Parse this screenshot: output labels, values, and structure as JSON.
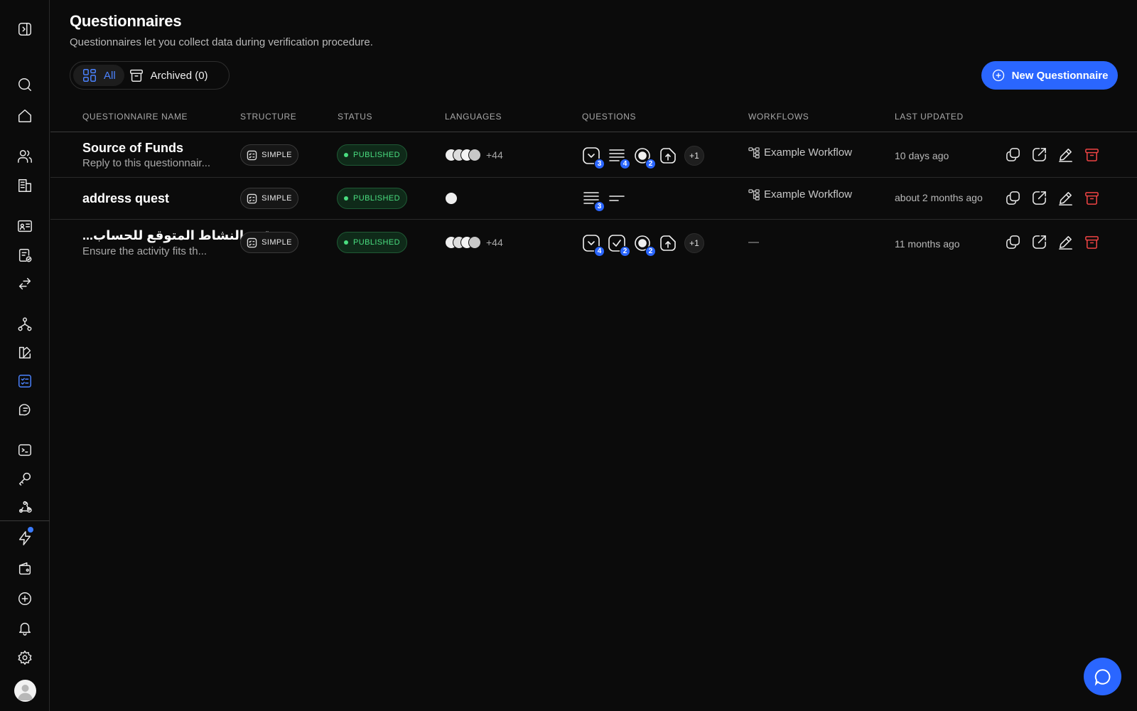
{
  "page": {
    "title": "Questionnaires",
    "subtitle": "Questionnaires let you collect data during verification procedure."
  },
  "filters": {
    "all_label": "All",
    "archived_label": "Archived (0)"
  },
  "new_button_label": "New Questionnaire",
  "table": {
    "columns": [
      "QUESTIONNAIRE NAME",
      "STRUCTURE",
      "STATUS",
      "LANGUAGES",
      "QUESTIONS",
      "WORKFLOWS",
      "LAST UPDATED"
    ],
    "rows": [
      {
        "name": "Source of Funds",
        "description": "Reply to this questionnair...",
        "structure": "SIMPLE",
        "status": "PUBLISHED",
        "languages_more": "+44",
        "questions": [
          {
            "icon": "dropdown-icon",
            "count": "3"
          },
          {
            "icon": "long-text-icon",
            "count": "4"
          },
          {
            "icon": "radio-icon",
            "count": "2"
          },
          {
            "icon": "file-upload-icon",
            "count": ""
          }
        ],
        "questions_more": "+1",
        "workflow": "Example Workflow",
        "last_updated": "10 days ago"
      },
      {
        "name": "address quest",
        "description": "",
        "structure": "SIMPLE",
        "status": "PUBLISHED",
        "languages_more": "",
        "questions": [
          {
            "icon": "long-text-icon",
            "count": "3"
          },
          {
            "icon": "short-text-icon",
            "count": ""
          }
        ],
        "questions_more": "",
        "workflow": "Example Workflow",
        "last_updated": "about 2 months ago"
      },
      {
        "name": "...قة والنشاط المتوقع للحساب",
        "description": "Ensure the activity fits th...",
        "structure": "SIMPLE",
        "status": "PUBLISHED",
        "languages_more": "+44",
        "questions": [
          {
            "icon": "dropdown-icon",
            "count": "4"
          },
          {
            "icon": "checkbox-icon",
            "count": "2"
          },
          {
            "icon": "radio-icon",
            "count": "2"
          },
          {
            "icon": "file-upload-icon",
            "count": ""
          }
        ],
        "questions_more": "+1",
        "workflow": "—",
        "last_updated": "11 months ago"
      }
    ]
  },
  "colors": {
    "accent": "#2a66ff",
    "published": "#4ade80",
    "danger": "#ef4444",
    "background": "#0b0b0b"
  }
}
